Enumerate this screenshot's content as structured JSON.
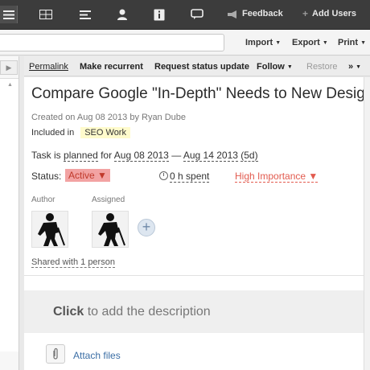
{
  "topbar": {
    "icons": [
      "menu-icon",
      "grid-icon",
      "list-icon",
      "person-icon",
      "info-icon",
      "chat-icon",
      "megaphone-icon",
      "plus-icon"
    ],
    "feedback_label": "Feedback",
    "add_users_label": "Add Users",
    "plus_glyph": "+"
  },
  "toolbar2": {
    "search_value": "",
    "import_label": "Import",
    "export_label": "Export",
    "print_label": "Print",
    "caret": "▼"
  },
  "leftcol": {
    "expand_glyph": "▶",
    "up_glyph": "▲"
  },
  "actions": {
    "permalink": "Permalink",
    "make_recurrent": "Make recurrent",
    "request_status_update": "Request status update",
    "follow": "Follow",
    "restore": "Restore",
    "more": "»"
  },
  "task": {
    "title": "Compare Google \"In-Depth\" Needs to New Design",
    "created": "Created on Aug 08 2013 by Ryan Dube",
    "included_label": "Included in",
    "folder_tag": "SEO Work",
    "plan_prefix": "Task is",
    "plan_word": "planned",
    "plan_for": "for",
    "start_date": "Aug 08 2013",
    "date_sep": "—",
    "end_date": "Aug 14 2013",
    "duration": "(5d)",
    "status_label": "Status:",
    "status_value": "Active ▼",
    "time_spent": "0 h spent",
    "importance": "High Importance ▼",
    "author_label": "Author",
    "assigned_label": "Assigned",
    "add_glyph": "+",
    "shared": "Shared with 1 person",
    "description_click": "Click",
    "description_rest": " to add the description",
    "attach_label": "Attach files"
  },
  "colors": {
    "topbar_bg": "#3c3c3c",
    "status_pill_bg": "#f2a3a3",
    "status_text": "#c0392b",
    "importance": "#e25b4f",
    "tag_bg": "#fffbcc",
    "link": "#3b6ea5"
  }
}
